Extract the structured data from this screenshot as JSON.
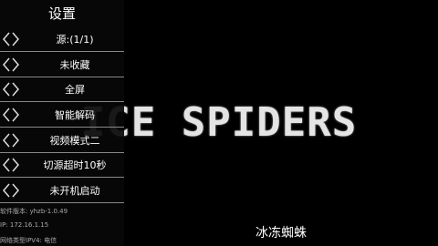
{
  "video": {
    "title_art": "ICE SPIDERS",
    "subtitle": "冰冻蜘蛛"
  },
  "settings_panel": {
    "title": "设置",
    "items": [
      {
        "label": "源:(1/1)"
      },
      {
        "label": "未收藏"
      },
      {
        "label": "全屏"
      },
      {
        "label": "智能解码"
      },
      {
        "label": "视频模式二"
      },
      {
        "label": "切源超时10秒"
      },
      {
        "label": "未开机启动"
      }
    ],
    "info": {
      "version": "软件版本: yhzb-1.0.49",
      "ip": "IP: 172.16.1.15",
      "network": "网络类型IPV4: 电信"
    }
  },
  "colors": {
    "panel_bg": "#080808",
    "divider": "#888888",
    "text": "#ffffff"
  }
}
